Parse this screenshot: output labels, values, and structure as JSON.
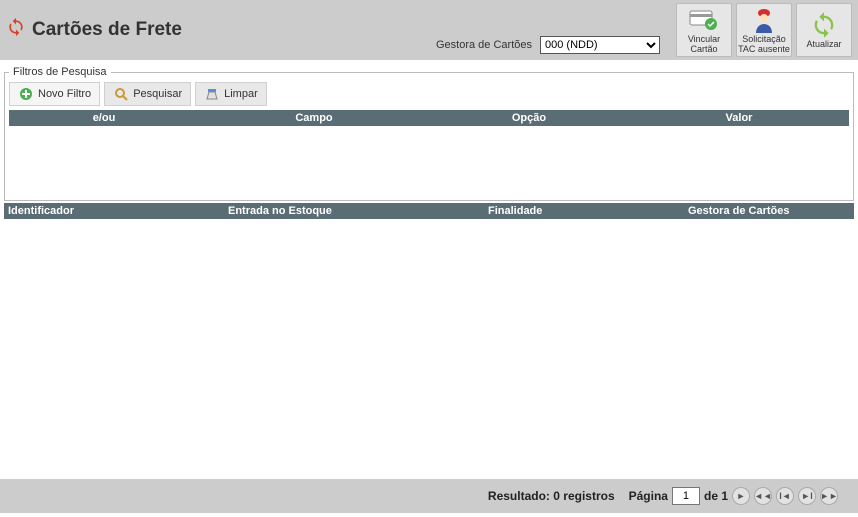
{
  "header": {
    "title": "Cartões de Frete",
    "gestora_label": "Gestora de Cartões",
    "gestora_selected": "000 (NDD)",
    "btn_vincular": "Vincular Cartão",
    "btn_solicitacao": "Solicitação TAC ausente",
    "btn_atualizar": "Atualizar"
  },
  "filters": {
    "legend": "Filtros de Pesquisa",
    "novo_filtro": "Novo Filtro",
    "pesquisar": "Pesquisar",
    "limpar": "Limpar",
    "col_eou": "e/ou",
    "col_campo": "Campo",
    "col_opcao": "Opção",
    "col_valor": "Valor"
  },
  "grid": {
    "col_identificador": "Identificador",
    "col_entrada": "Entrada no Estoque",
    "col_finalidade": "Finalidade",
    "col_gestora": "Gestora de Cartões"
  },
  "footer": {
    "resultado": "Resultado: 0 registros",
    "pagina_label": "Página",
    "pagina_value": "1",
    "de_label": "de 1"
  }
}
